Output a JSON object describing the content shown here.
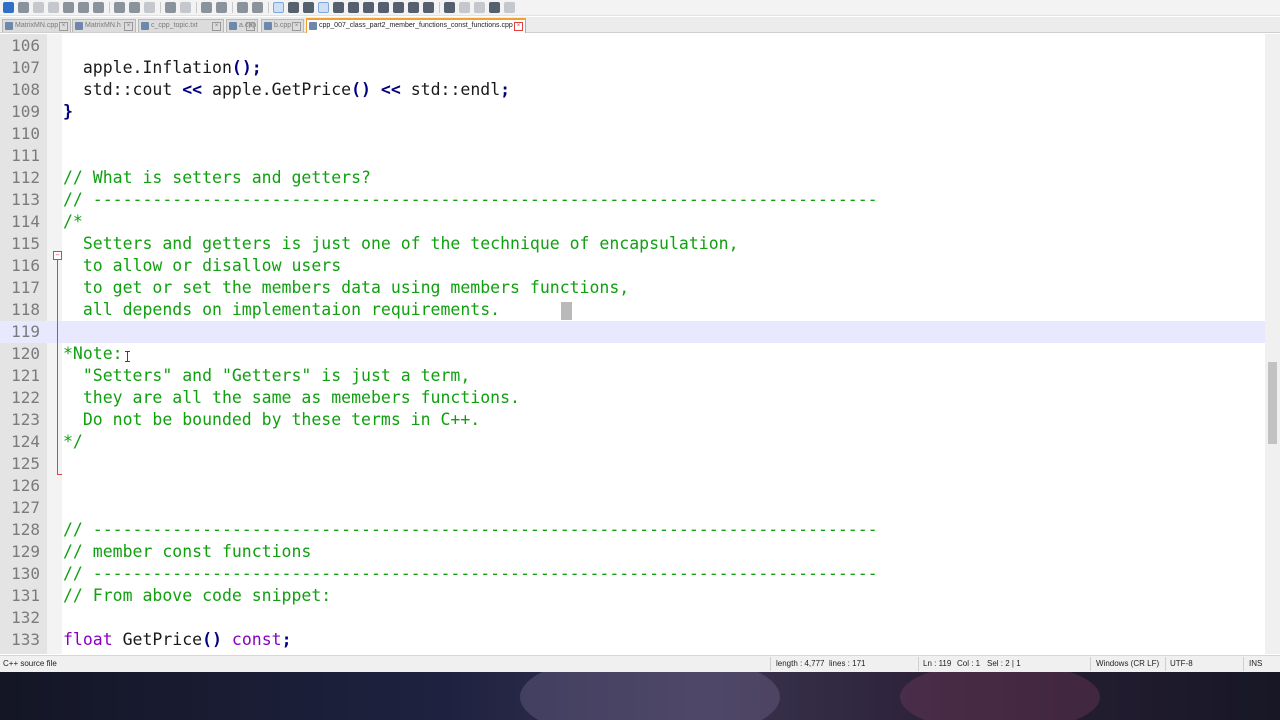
{
  "toolbar": {
    "icons": [
      "new-file-icon",
      "open-icon",
      "save-icon",
      "save-all-icon",
      "close-icon",
      "close-all-icon",
      "print-icon",
      "cut-icon",
      "copy-icon",
      "paste-icon",
      "undo-icon",
      "redo-icon",
      "find-icon",
      "replace-icon",
      "zoom-in-icon",
      "zoom-out-icon",
      "sync-scroll-icon",
      "show-all-chars-icon",
      "indent-guide-icon",
      "word-wrap-icon",
      "xml-icon",
      "doc-map-icon",
      "function-list-icon",
      "folder-workspace-icon",
      "monitor-icon",
      "record-macro-icon",
      "stop-record-icon",
      "play-macro-icon",
      "run-macro-multiple-icon",
      "save-macro-icon"
    ]
  },
  "tabs": [
    {
      "label": "MatrixMN.cpp",
      "active": false
    },
    {
      "label": "MatrixMN.h",
      "active": false
    },
    {
      "label": "c_cpp_topic.txt",
      "active": false
    },
    {
      "label": "a.cpp",
      "active": false
    },
    {
      "label": "b.cpp",
      "active": false
    },
    {
      "label": "cpp_007_class_part2_member_functions_const_functions.cpp",
      "active": true
    }
  ],
  "editor": {
    "lines": [
      {
        "n": "106",
        "t": "",
        "c": "code"
      },
      {
        "n": "107",
        "t": "  apple.Inflation();",
        "c": "code"
      },
      {
        "n": "108",
        "t": "  std::cout << apple.GetPrice() << std::endl;",
        "c": "code"
      },
      {
        "n": "109",
        "t": "}",
        "c": "code"
      },
      {
        "n": "110",
        "t": "",
        "c": "code"
      },
      {
        "n": "111",
        "t": "",
        "c": "code"
      },
      {
        "n": "112",
        "t": "// What is setters and getters?",
        "c": "cm"
      },
      {
        "n": "113",
        "t": "// -------------------------------------------------------------------------------",
        "c": "cm"
      },
      {
        "n": "114",
        "t": "/*",
        "c": "cm"
      },
      {
        "n": "115",
        "t": "  Setters and getters is just one of the technique of encapsulation,",
        "c": "cm"
      },
      {
        "n": "116",
        "t": "  to allow or disallow users",
        "c": "cm"
      },
      {
        "n": "117",
        "t": "  to get or set the members data using members functions,",
        "c": "cm"
      },
      {
        "n": "118",
        "t": "  all depends on implementaion requirements.",
        "c": "cm"
      },
      {
        "n": "119",
        "t": "",
        "c": "cm"
      },
      {
        "n": "120",
        "t": "*Note:",
        "c": "cm"
      },
      {
        "n": "121",
        "t": "  \"Setters\" and \"Getters\" is just a term,",
        "c": "cm"
      },
      {
        "n": "122",
        "t": "  they are all the same as memebers functions.",
        "c": "cm"
      },
      {
        "n": "123",
        "t": "  Do not be bounded by these terms in C++.",
        "c": "cm"
      },
      {
        "n": "124",
        "t": "*/",
        "c": "cm"
      },
      {
        "n": "125",
        "t": "",
        "c": "code"
      },
      {
        "n": "126",
        "t": "",
        "c": "code"
      },
      {
        "n": "127",
        "t": "",
        "c": "code"
      },
      {
        "n": "128",
        "t": "// -------------------------------------------------------------------------------",
        "c": "cm"
      },
      {
        "n": "129",
        "t": "// member const functions",
        "c": "cm"
      },
      {
        "n": "130",
        "t": "// -------------------------------------------------------------------------------",
        "c": "cm"
      },
      {
        "n": "131",
        "t": "// From above code snippet:",
        "c": "cm"
      },
      {
        "n": "132",
        "t": "",
        "c": "code"
      },
      {
        "n": "133",
        "t": "float GetPrice() const;",
        "c": "code"
      }
    ],
    "current_line_number": "119"
  },
  "status": {
    "file_type": "C++ source file",
    "length": "length : 4,777",
    "lines": "lines : 171",
    "ln": "Ln : 119",
    "col": "Col : 1",
    "sel": "Sel : 2 | 1",
    "eol": "Windows (CR LF)",
    "encoding": "UTF-8",
    "mode": "INS"
  },
  "colors": {
    "comment": "#10a010",
    "keyword": "#8a00c2",
    "operator": "#000080",
    "current_line": "#e8e8ff",
    "active_tab_accent": "#f0a030"
  }
}
